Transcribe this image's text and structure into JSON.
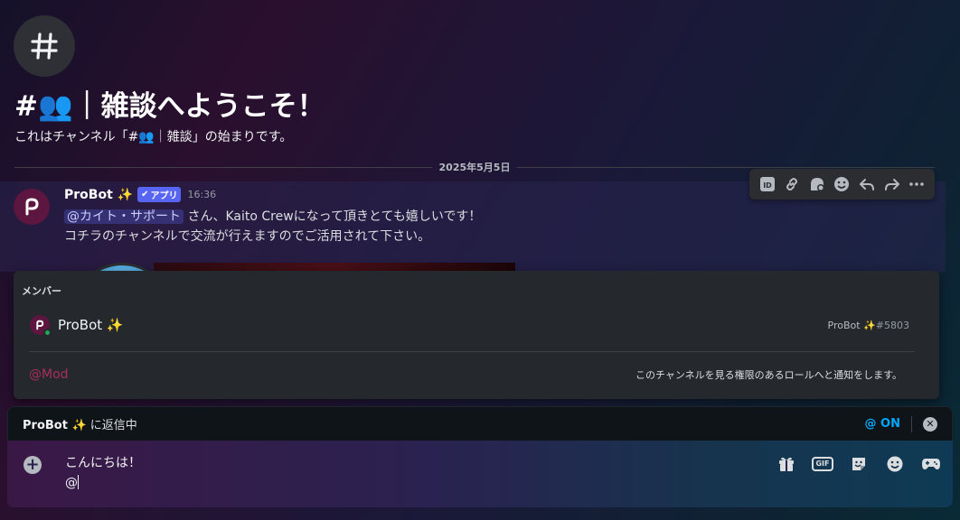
{
  "channel": {
    "welcome_title": "#👥｜雑談へようこそ！",
    "welcome_subtitle": "これはチャンネル「#👥｜雑談」の始まりです。"
  },
  "date_divider": "2025年5月5日",
  "message": {
    "author": "ProBot ✨",
    "badge": "アプリ",
    "timestamp": "16:36",
    "mention": "@カイト・サポート",
    "line1_rest": " さん、Kaito Crewになって頂きとても嬉しいです！",
    "line2": "コチラのチャンネルで交流が行えますのでご活用されて下さい。"
  },
  "toolbar_icons": [
    "id-icon",
    "link-icon",
    "thread-icon",
    "emoji-icon",
    "reply-icon",
    "forward-icon",
    "more-icon"
  ],
  "member_popup": {
    "header": "メンバー",
    "member_name": "ProBot ✨",
    "member_tag": "ProBot ✨",
    "member_discriminator": "#5803",
    "role_name": "@Mod",
    "role_description": "このチャンネルを見る権限のあるロールへと通知をします。"
  },
  "reply_bar": {
    "target": "ProBot ✨",
    "suffix": " に返信中",
    "mention_toggle": "@ ON"
  },
  "composer": {
    "line1": "こんにちは！",
    "line2": "@"
  },
  "colors": {
    "accent": "#5865f2",
    "role": "#a72f5a",
    "online": "#23a55a",
    "mention_toggle": "#00a8fc"
  }
}
